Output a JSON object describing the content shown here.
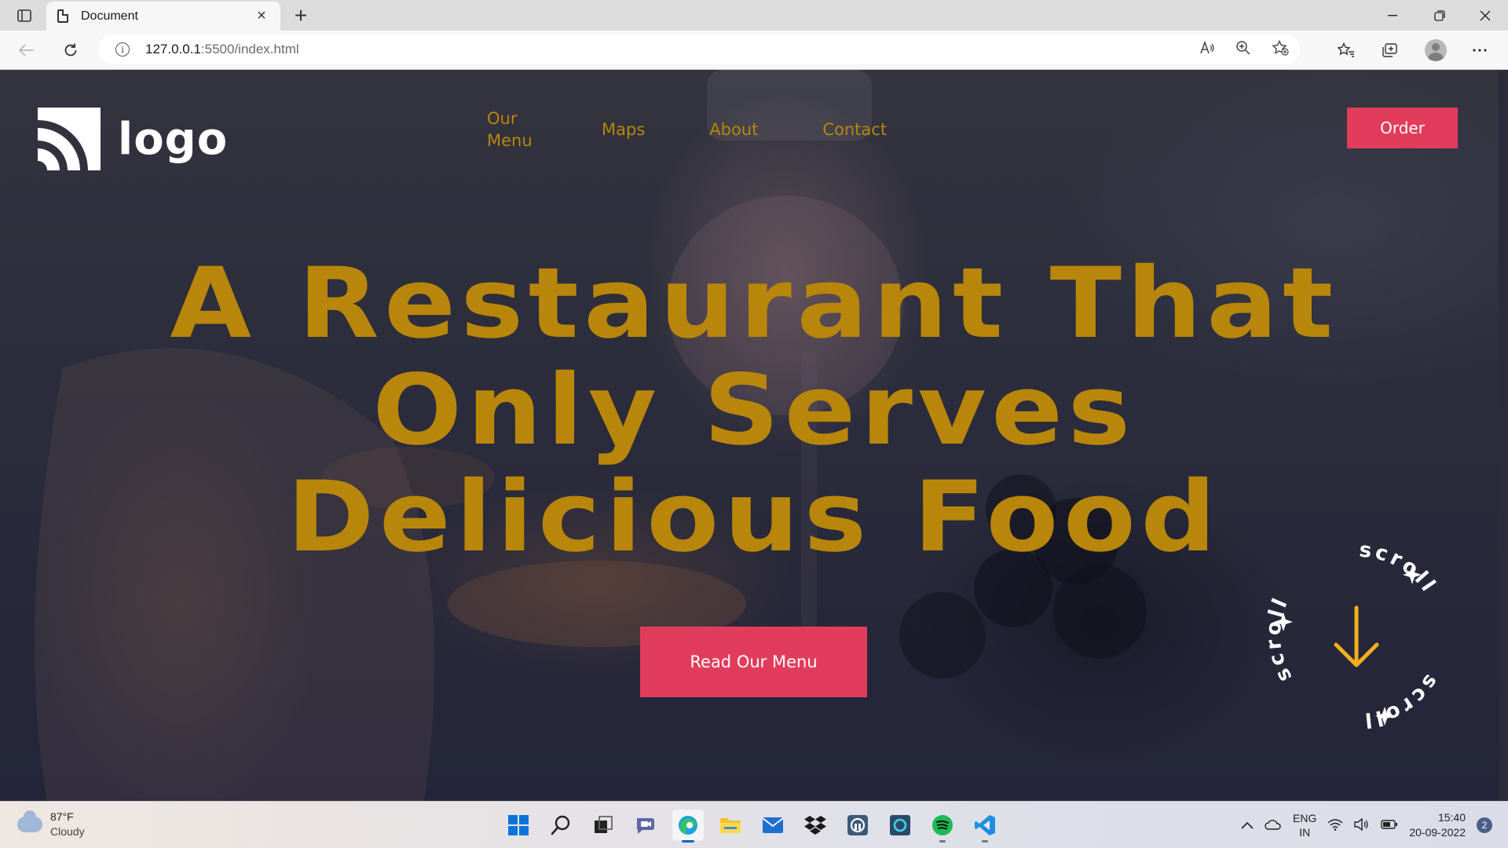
{
  "browser": {
    "tab_title": "Document",
    "url_host": "127.0.0.1",
    "url_path": ":5500/index.html"
  },
  "site": {
    "logo_text": "logo",
    "nav": [
      {
        "label": "Our Menu"
      },
      {
        "label": "Maps"
      },
      {
        "label": "About"
      },
      {
        "label": "Contact"
      }
    ],
    "order_label": "Order",
    "hero_lines": [
      "A Restaurant That",
      "Only Serves",
      "Delicious Food"
    ],
    "cta_label": "Read Our Menu",
    "scroll_text": "scroll",
    "colors": {
      "accent": "#b8860b",
      "button": "#e23c5c",
      "bg": "#2c2d3c"
    }
  },
  "taskbar": {
    "weather_temp": "87°F",
    "weather_desc": "Cloudy",
    "lang_line1": "ENG",
    "lang_line2": "IN",
    "time": "15:40",
    "date": "20-09-2022",
    "notifications": "2",
    "apps": [
      "windows-start",
      "search",
      "task-view",
      "teams-chat",
      "edge",
      "file-explorer",
      "mail",
      "dropbox",
      "app-a",
      "cortana",
      "spotify",
      "vscode"
    ]
  }
}
